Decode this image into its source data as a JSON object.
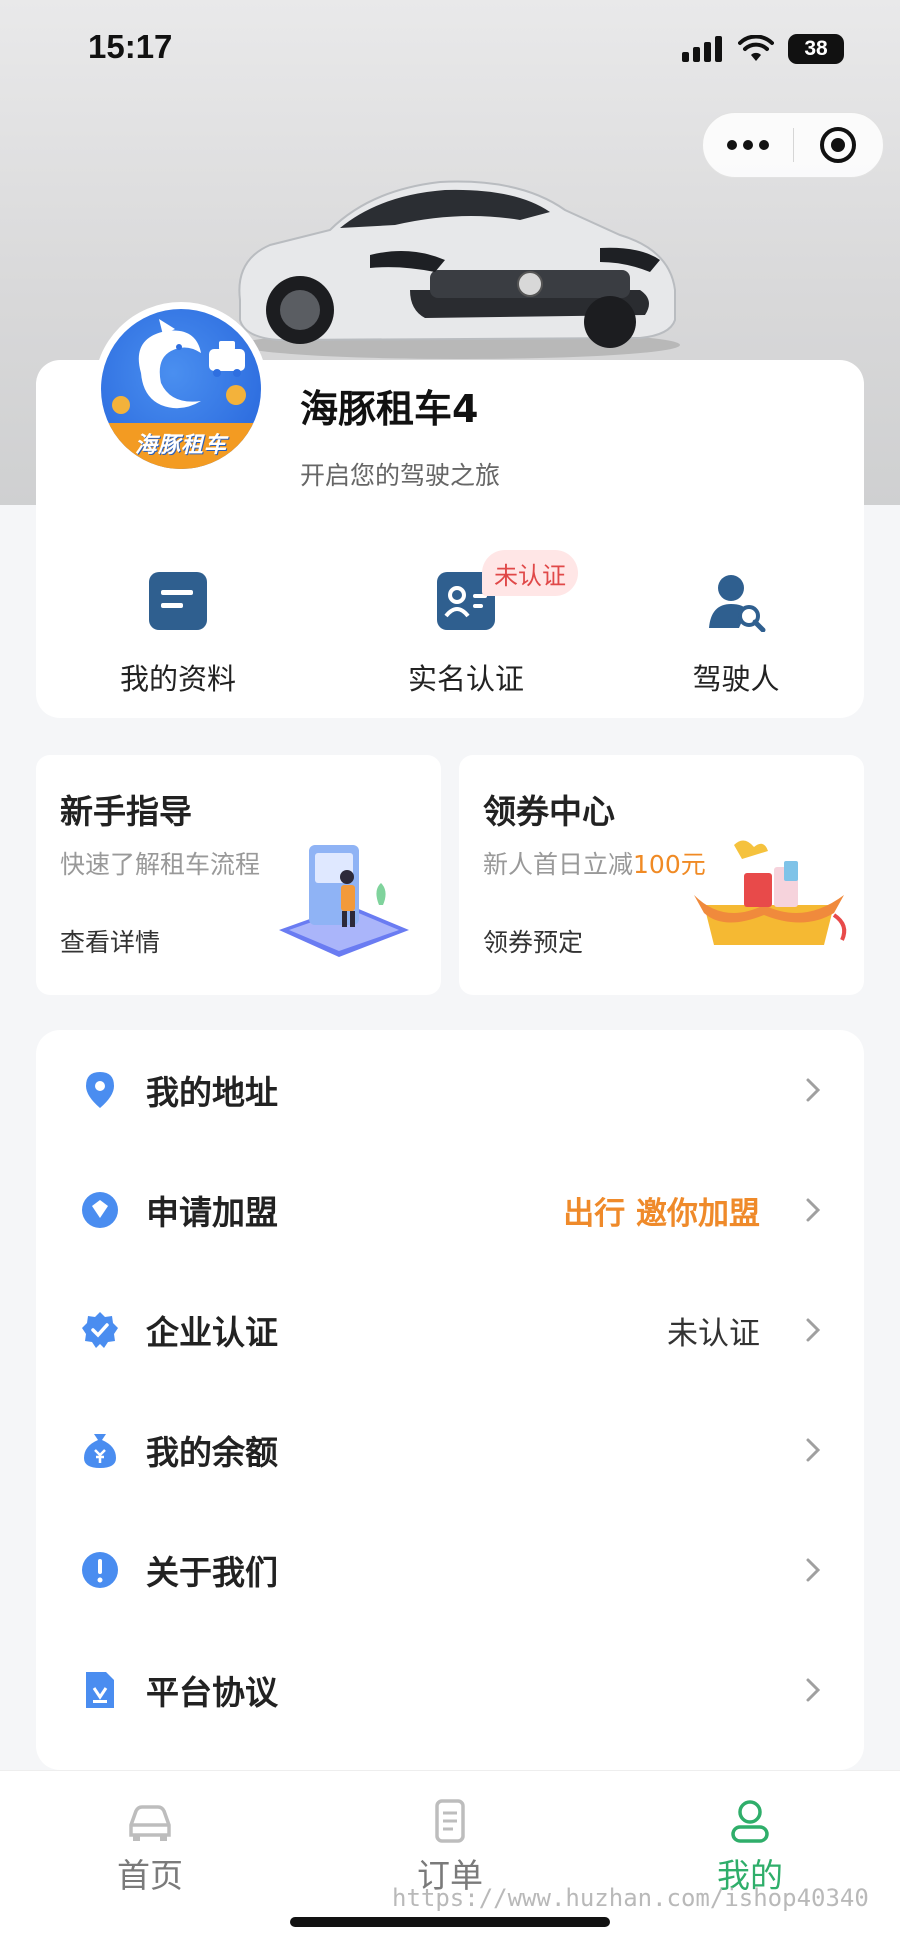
{
  "status_bar": {
    "time": "15:17",
    "battery": "38"
  },
  "profile": {
    "name": "海豚租车4",
    "subtitle": "开启您的驾驶之旅",
    "avatar_text": "海豚租车"
  },
  "quick_actions": [
    {
      "label": "我的资料",
      "icon": "document-icon"
    },
    {
      "label": "实名认证",
      "icon": "id-card-icon",
      "badge": "未认证"
    },
    {
      "label": "驾驶人",
      "icon": "driver-search-icon"
    }
  ],
  "promos": [
    {
      "title": "新手指导",
      "subtitle": "快速了解租车流程",
      "link": "查看详情"
    },
    {
      "title": "领券中心",
      "subtitle_prefix": "新人首日立减",
      "subtitle_highlight": "100元",
      "link": "领券预定"
    }
  ],
  "menu": [
    {
      "label": "我的地址",
      "value": "",
      "icon": "location-pin-icon"
    },
    {
      "label": "申请加盟",
      "value": "出行 邀你加盟",
      "icon": "franchise-tag-icon"
    },
    {
      "label": "企业认证",
      "value": "未认证",
      "icon": "verified-badge-icon"
    },
    {
      "label": "我的余额",
      "value": "",
      "icon": "money-bag-icon"
    },
    {
      "label": "关于我们",
      "value": "",
      "icon": "info-icon"
    },
    {
      "label": "平台协议",
      "value": "",
      "icon": "agreement-doc-icon"
    }
  ],
  "tabs": [
    {
      "label": "首页",
      "icon": "car-icon",
      "active": false
    },
    {
      "label": "订单",
      "icon": "order-list-icon",
      "active": false
    },
    {
      "label": "我的",
      "icon": "user-icon",
      "active": true
    }
  ],
  "watermark": "https://www.huzhan.com/ishop40340",
  "colors": {
    "accent_blue": "#2f6fe0",
    "active_green": "#2fae6a",
    "highlight_orange": "#f08a24",
    "badge_red": "#e04848"
  }
}
